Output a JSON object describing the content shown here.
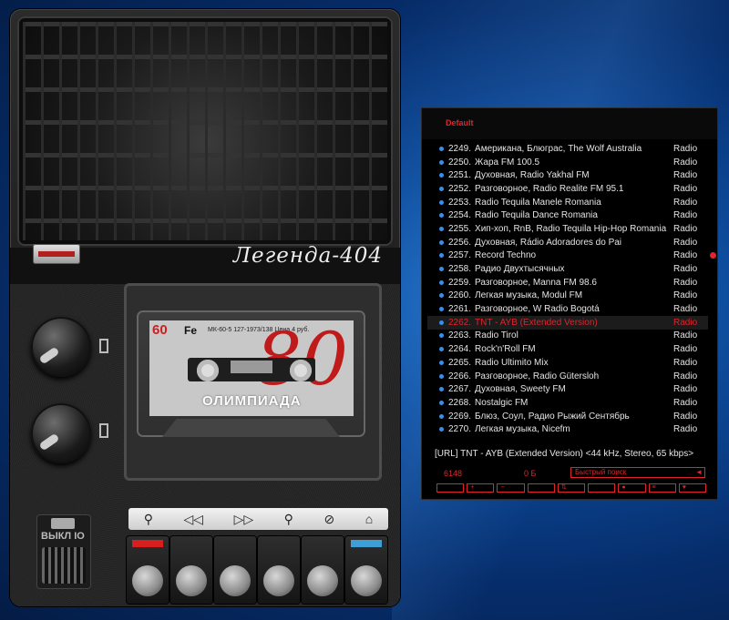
{
  "player": {
    "brand": "Легенда-404",
    "cassette": {
      "length": "60",
      "type": "Fe",
      "spec": "МК-60-5 127-1973/138 Цена 4 руб.",
      "title": "ОЛИМПИАДА",
      "number": "80"
    },
    "switch_label": "ВЫКЛ IO",
    "keys": [
      "⚲",
      "◁◁",
      "▷▷",
      "⚲",
      "⊘",
      "⌂"
    ],
    "colors": {
      "rec": "#d81f1f",
      "play": "#3d9fd6"
    }
  },
  "playlist": {
    "name": "Default",
    "rows": [
      {
        "n": "2249.",
        "title": "Американа, Блюграс, The Wolf Australia",
        "genre": "Radio"
      },
      {
        "n": "2250.",
        "title": "Жара FM 100.5",
        "genre": "Radio"
      },
      {
        "n": "2251.",
        "title": "Духовная, Radio Yakhal FM",
        "genre": "Radio"
      },
      {
        "n": "2252.",
        "title": "Разговорное, Radio Realite FM 95.1",
        "genre": "Radio"
      },
      {
        "n": "2253.",
        "title": "Radio Tequila Manele Romania",
        "genre": "Radio"
      },
      {
        "n": "2254.",
        "title": "Radio Tequila Dance Romania",
        "genre": "Radio"
      },
      {
        "n": "2255.",
        "title": "Хип-хоп, RnB, Radio Tequila Hip-Hop Romania",
        "genre": "Radio"
      },
      {
        "n": "2256.",
        "title": "Духовная, Rádio Adoradores do Pai",
        "genre": "Radio"
      },
      {
        "n": "2257.",
        "title": "Record Techno",
        "genre": "Radio"
      },
      {
        "n": "2258.",
        "title": "Радио Двухтысячных",
        "genre": "Radio"
      },
      {
        "n": "2259.",
        "title": "Разговорное, Manna FM 98.6",
        "genre": "Radio"
      },
      {
        "n": "2260.",
        "title": "Легкая музыка, Modul FM",
        "genre": "Radio"
      },
      {
        "n": "2261.",
        "title": "Разговорное, W Radio Bogotá",
        "genre": "Radio"
      },
      {
        "n": "2262.",
        "title": "TNT - AYB (Extended Version)",
        "genre": "Radio"
      },
      {
        "n": "2263.",
        "title": "Radio Tirol",
        "genre": "Radio"
      },
      {
        "n": "2264.",
        "title": "Rock'n'Roll FM",
        "genre": "Radio"
      },
      {
        "n": "2265.",
        "title": "Radio Ultimito Mix",
        "genre": "Radio"
      },
      {
        "n": "2266.",
        "title": "Разговорное, Radio Gütersloh",
        "genre": "Radio"
      },
      {
        "n": "2267.",
        "title": "Духовная, Sweety FM",
        "genre": "Radio"
      },
      {
        "n": "2268.",
        "title": "Nostalgic FM",
        "genre": "Radio"
      },
      {
        "n": "2269.",
        "title": "Блюз, Соул, Радио Рыжий Сентябрь",
        "genre": "Radio"
      },
      {
        "n": "2270.",
        "title": "Легкая музыка, Nicefm",
        "genre": "Radio"
      }
    ],
    "selected_index": 13,
    "now_playing": "[URL] TNT - AYB (Extended Version) <44 kHz, Stereo, 65 kbps>",
    "count": "6148",
    "size": "0 Б",
    "search_placeholder": "Быстрый поиск",
    "toolbar": [
      "",
      "+",
      "−",
      "",
      "⇅",
      "",
      "●",
      "≡",
      "♥"
    ],
    "colors": {
      "accent": "#e0242b",
      "dot": "#3a8ee8"
    }
  }
}
